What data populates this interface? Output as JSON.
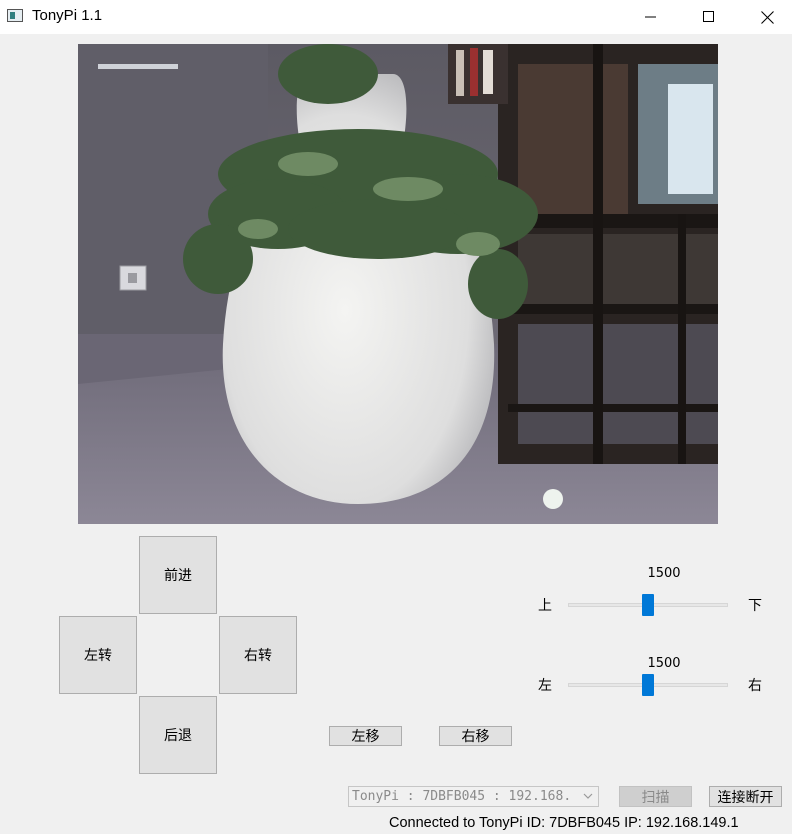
{
  "window": {
    "title": "TonyPi 1.1",
    "icons": [
      "app-icon",
      "minimize-icon",
      "maximize-icon",
      "close-icon"
    ]
  },
  "camera": {
    "icon": "camera-feed-image"
  },
  "movement": {
    "forward_label": "前进",
    "turn_left_label": "左转",
    "turn_right_label": "右转",
    "backward_label": "后退",
    "shift_left_label": "左移",
    "shift_right_label": "右移"
  },
  "head_tilt": {
    "value": "1500",
    "min_label": "上",
    "max_label": "下",
    "range": [
      500,
      2500
    ],
    "position_value": 1500
  },
  "head_pan": {
    "value": "1500",
    "min_label": "左",
    "max_label": "右",
    "range": [
      500,
      2500
    ],
    "position_value": 1500
  },
  "connection": {
    "device_select_value": "TonyPi : 7DBFB045 : 192.168.",
    "scan_label": "扫描",
    "disconnect_label": "连接断开",
    "status_text": "Connected to TonyPi  ID: 7DBFB045  IP: 192.168.149.1"
  },
  "colors": {
    "accent": "#0078d7",
    "button_bg": "#e1e1e1",
    "window_bg": "#f0f0f0"
  }
}
